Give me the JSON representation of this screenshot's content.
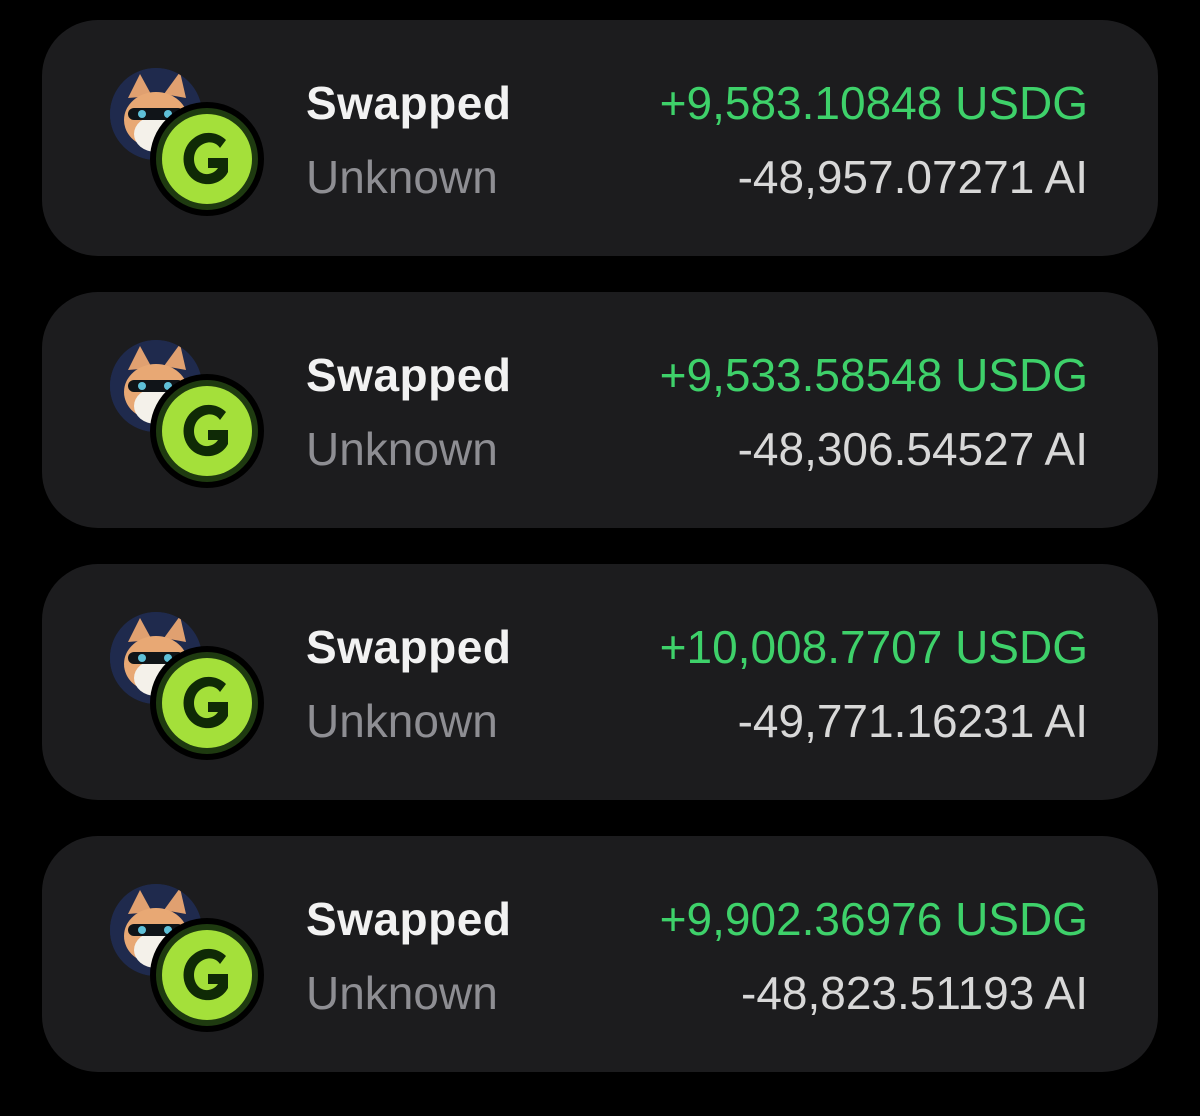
{
  "colors": {
    "background": "#000000",
    "card": "#1c1c1e",
    "positive": "#3ed16a",
    "negative": "#d8d8d8",
    "muted": "#8e8e93"
  },
  "transactions": [
    {
      "type": "Swapped",
      "counterparty": "Unknown",
      "amount_in": "+9,583.10848 USDG",
      "amount_out": "-48,957.07271 AI",
      "icons": [
        "cat-token-icon",
        "usdg-coin-icon"
      ]
    },
    {
      "type": "Swapped",
      "counterparty": "Unknown",
      "amount_in": "+9,533.58548 USDG",
      "amount_out": "-48,306.54527 AI",
      "icons": [
        "cat-token-icon",
        "usdg-coin-icon"
      ]
    },
    {
      "type": "Swapped",
      "counterparty": "Unknown",
      "amount_in": "+10,008.7707 USDG",
      "amount_out": "-49,771.16231 AI",
      "icons": [
        "cat-token-icon",
        "usdg-coin-icon"
      ]
    },
    {
      "type": "Swapped",
      "counterparty": "Unknown",
      "amount_in": "+9,902.36976 USDG",
      "amount_out": "-48,823.51193 AI",
      "icons": [
        "cat-token-icon",
        "usdg-coin-icon"
      ]
    }
  ]
}
